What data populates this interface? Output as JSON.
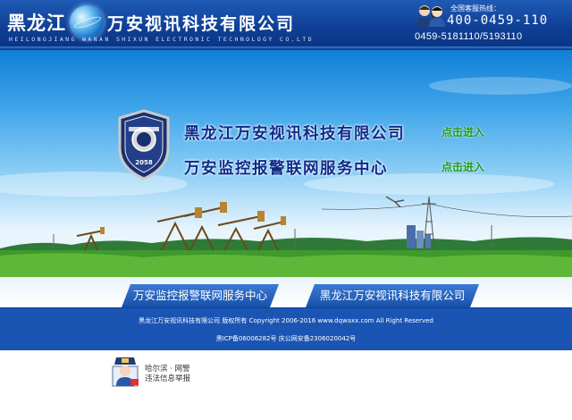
{
  "header": {
    "brand_prefix": "黑龙江",
    "brand_suffix": "万安视讯科技有限公司",
    "brand_english": "HEILONGJIANG WANAN SHIXUN ELECTRONIC TECHNOLOGY  CO.LTD",
    "logo_icon": "globe-icon",
    "support": {
      "label": "全国客服热线：",
      "hotline": "400-0459-110",
      "local_numbers": "0459-5181110/5193110",
      "icon": "customer-service-agents-icon"
    }
  },
  "banner": {
    "emblem_icon": "security-badge-icon",
    "entries": [
      {
        "title": "黑龙江万安视讯科技有限公司",
        "link": "点击进入"
      },
      {
        "title": "万安监控报警联网服务中心",
        "link": "点击进入"
      }
    ]
  },
  "footer": {
    "tabs": [
      {
        "label": "万安监控报警联网服务中心"
      },
      {
        "label": "黑龙江万安视讯科技有限公司"
      }
    ],
    "copyright": "黑龙江万安视讯科技有限公司 版权所有 Copyright 2006-2016 www.dqwaxx.com All Right Reserved",
    "icp": "黑ICP备06006282号 庆公网安备2306020042号",
    "police_badge": {
      "icon": "police-officer-icon",
      "line1": "哈尔滨 · 网警",
      "line2": "违法信息举报"
    }
  },
  "colors": {
    "header_blue": "#0f3f96",
    "footer_blue": "#1b55b4",
    "title_navy": "#0d2b8a",
    "link_green": "#1c9a1c"
  }
}
